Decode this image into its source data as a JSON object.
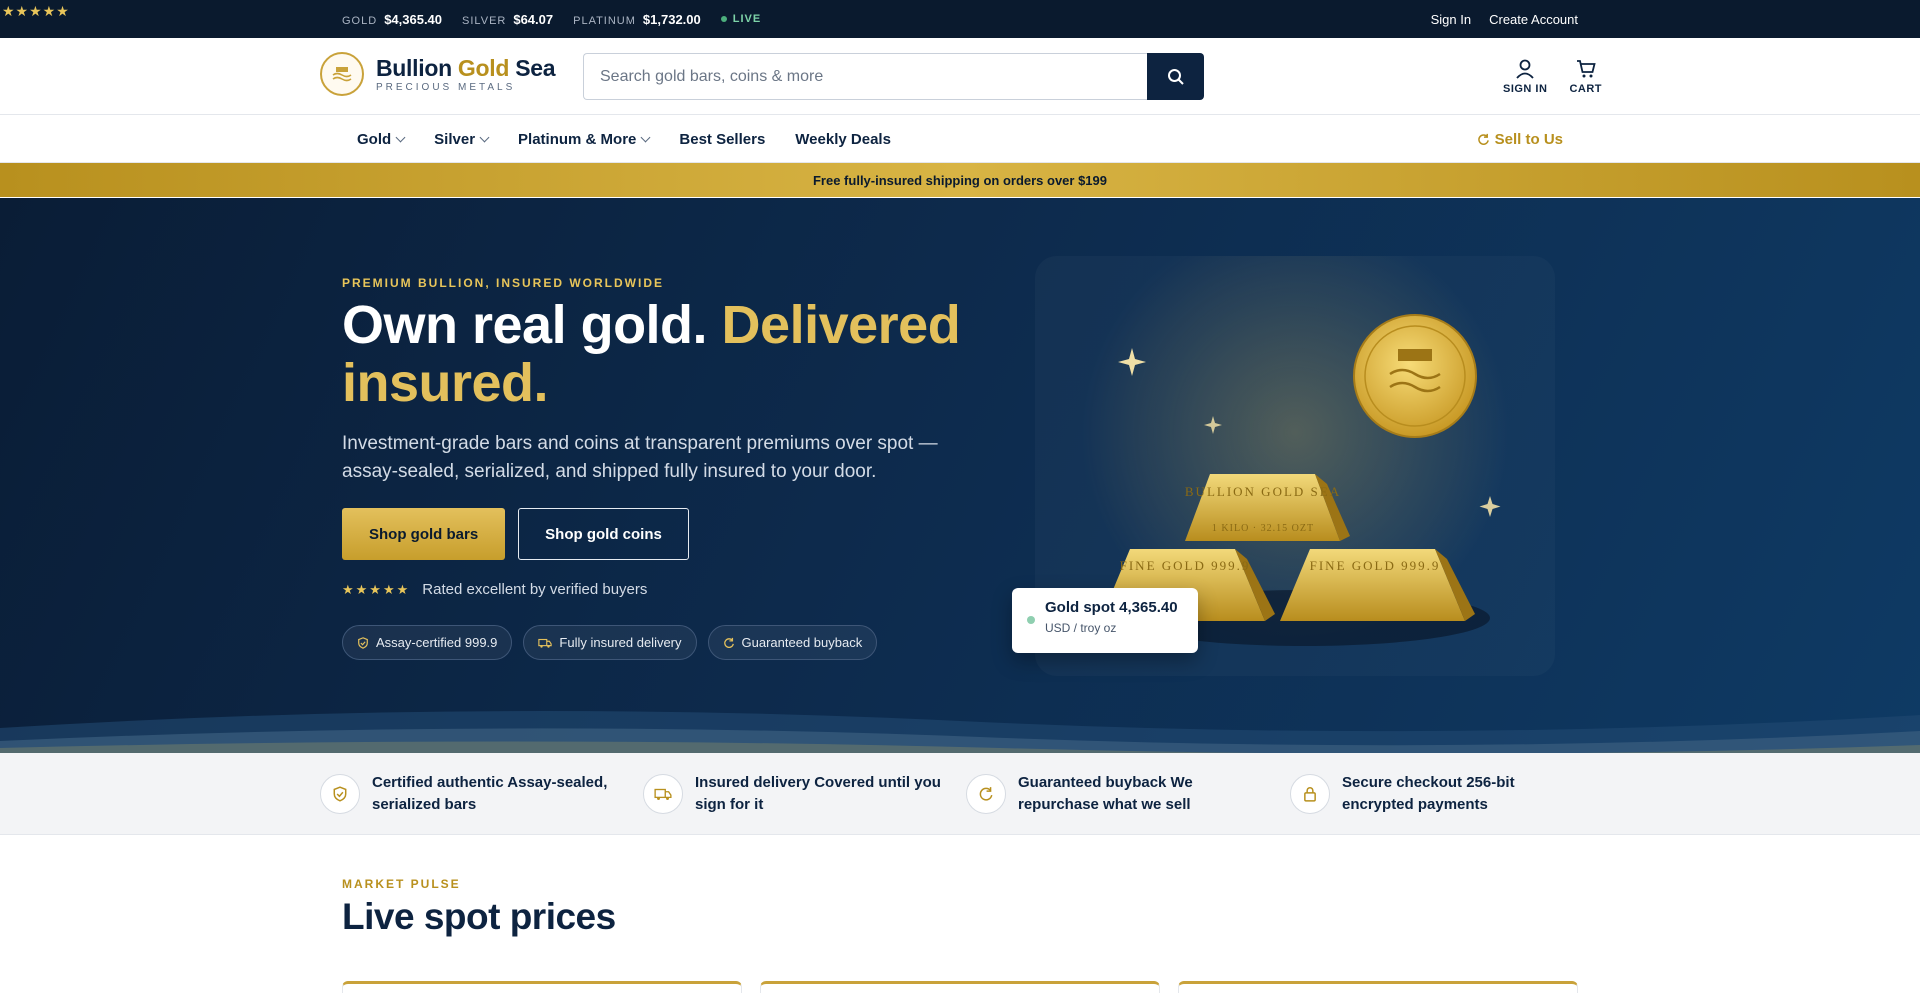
{
  "ticker": {
    "rating_stars": "★★★★★",
    "prices": [
      {
        "metal": "GOLD",
        "price": "$4,365.40"
      },
      {
        "metal": "SILVER",
        "price": "$64.07"
      },
      {
        "metal": "PLATINUM",
        "price": "$1,732.00"
      }
    ],
    "live_label": "LIVE",
    "sign_in": "Sign In",
    "create_account": "Create Account"
  },
  "header": {
    "brand_part1": "Bullion ",
    "brand_gold": "Gold",
    "brand_part2": " Sea",
    "brand_sub": "PRECIOUS METALS",
    "search_placeholder": "Search gold bars, coins & more",
    "signin_label": "SIGN IN",
    "cart_label": "CART"
  },
  "nav": {
    "items": [
      {
        "label": "Gold",
        "dropdown": true
      },
      {
        "label": "Silver",
        "dropdown": true
      },
      {
        "label": "Platinum & More",
        "dropdown": true
      },
      {
        "label": "Best Sellers",
        "dropdown": false
      },
      {
        "label": "Weekly Deals",
        "dropdown": false
      }
    ],
    "sell": "Sell to Us"
  },
  "promo": "Free fully-insured shipping on orders over $199",
  "hero": {
    "kicker": "PREMIUM BULLION, INSURED WORLDWIDE",
    "title_white": "Own real gold. ",
    "title_gold": "Delivered insured.",
    "lede": "Investment-grade bars and coins at transparent premiums over spot — assay-sealed, serialized, and shipped fully insured to your door.",
    "btn_primary": "Shop gold bars",
    "btn_secondary": "Shop gold coins",
    "stars": "★★★★★",
    "rating_text": "Rated excellent by verified buyers",
    "chips": [
      "Assay-certified 999.9",
      "Fully insured delivery",
      "Guaranteed buyback"
    ],
    "bar_top_engraving": "BULLION GOLD SEA",
    "bar_top_sub": "1 KILO · 32.15 OZT",
    "bar_left_engraving": "FINE GOLD 999.9",
    "bar_right_engraving": "FINE GOLD 999.9",
    "spot_card_title": "Gold spot 4,365.40",
    "spot_card_sub": "USD / troy oz"
  },
  "features": [
    {
      "icon": "shield-check-icon",
      "text": "Certified authentic Assay-sealed, serialized bars"
    },
    {
      "icon": "truck-icon",
      "text": "Insured delivery Covered until you sign for it"
    },
    {
      "icon": "refresh-icon",
      "text": "Guaranteed buyback We repurchase what we sell"
    },
    {
      "icon": "lock-icon",
      "text": "Secure checkout 256-bit encrypted payments"
    }
  ],
  "market": {
    "kicker": "MARKET PULSE",
    "title": "Live spot prices"
  },
  "colors": {
    "navy": "#0d2340",
    "gold": "#c9a23a",
    "gold_text": "#e3c05c"
  }
}
